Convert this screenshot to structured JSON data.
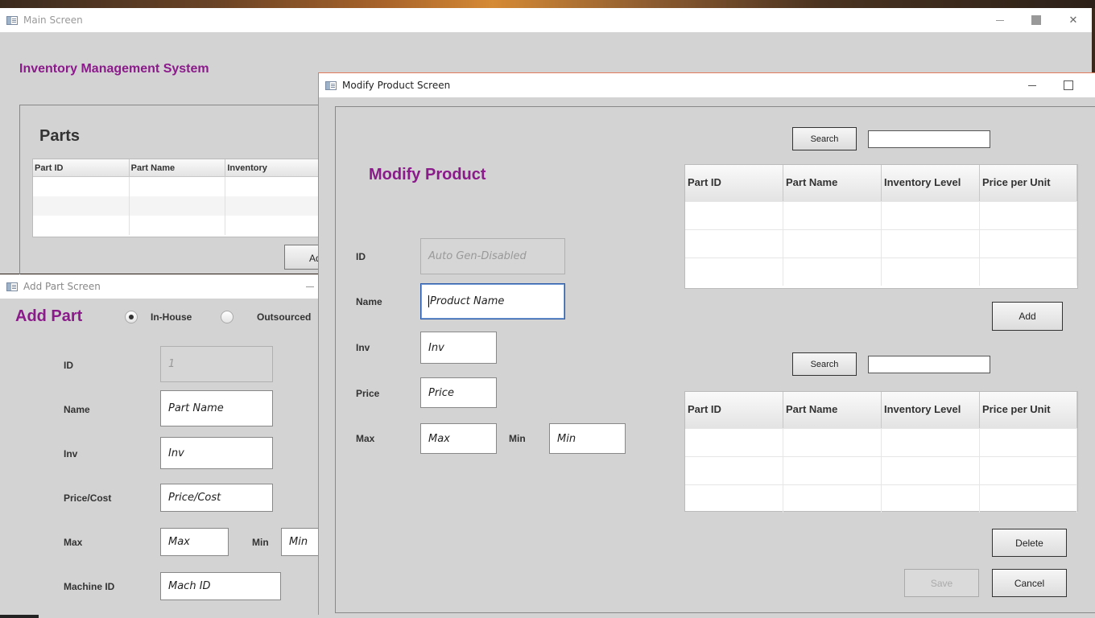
{
  "main": {
    "window_title": "Main Screen",
    "app_title": "Inventory Management System",
    "parts_title": "Parts",
    "parts_columns": [
      "Part ID",
      "Part Name",
      "Inventory"
    ],
    "add_label": "Add"
  },
  "add_part": {
    "window_title": "Add Part Screen",
    "heading": "Add Part",
    "radio_inhouse": "In-House",
    "radio_outsourced": "Outsourced",
    "selected_radio": "In-House",
    "labels": {
      "id": "ID",
      "name": "Name",
      "inv": "Inv",
      "price": "Price/Cost",
      "max": "Max",
      "min": "Min",
      "machine": "Machine ID"
    },
    "fields": {
      "id": "1",
      "name": "Part Name",
      "inv": "Inv",
      "price": "Price/Cost",
      "max": "Max",
      "min": "Min",
      "machine": "Mach ID"
    }
  },
  "modify_product": {
    "window_title": "Modify Product Screen",
    "heading": "Modify Product",
    "labels": {
      "id": "ID",
      "name": "Name",
      "inv": "Inv",
      "price": "Price",
      "max": "Max",
      "min": "Min"
    },
    "fields": {
      "id": "Auto Gen-Disabled",
      "name": "Product Name",
      "inv": "Inv",
      "price": "Price",
      "max": "Max",
      "min": "Min"
    },
    "search_label": "Search",
    "search_label_2": "Search",
    "table_columns": [
      "Part ID",
      "Part Name",
      "Inventory Level",
      "Price per Unit"
    ],
    "add_label": "Add",
    "delete_label": "Delete",
    "save_label": "Save",
    "cancel_label": "Cancel"
  },
  "colors": {
    "heading_purple": "#8b1a8b",
    "window_bg": "#d3d3d3",
    "focus_border": "#2a5aa8",
    "active_window_border": "#e07a5a"
  },
  "icons": [
    "app-icon",
    "minimize-icon",
    "maximize-icon",
    "close-icon"
  ]
}
